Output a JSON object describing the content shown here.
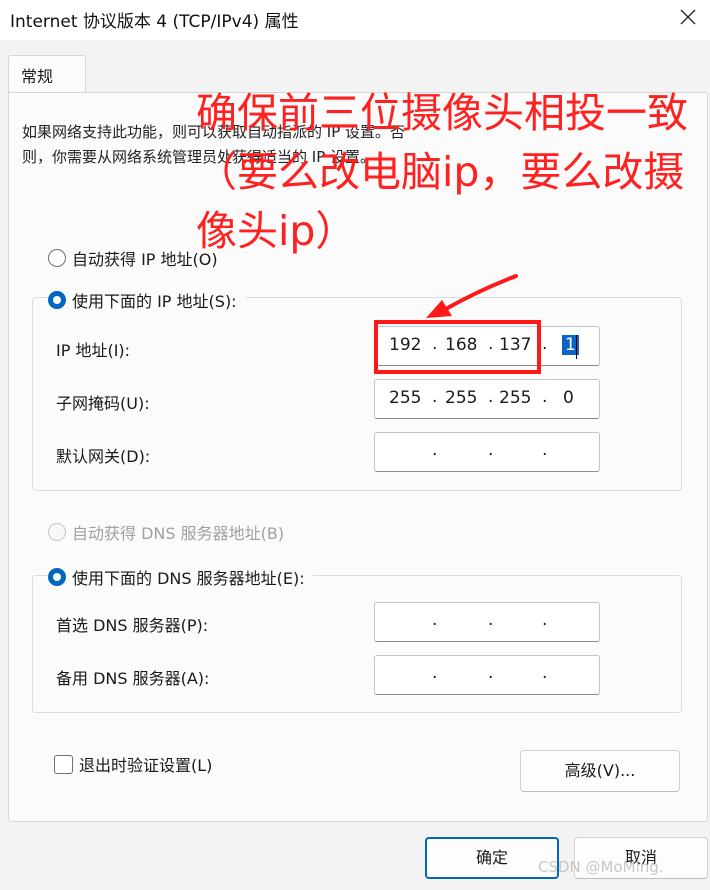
{
  "window": {
    "title": "Internet 协议版本 4 (TCP/IPv4) 属性",
    "close_icon": "close-icon"
  },
  "tabs": [
    {
      "label": "常规",
      "active": true
    }
  ],
  "description": "如果网络支持此功能，则可以获取自动指派的 IP 设置。否则，你需要从网络系统管理员处获得适当的 IP 设置。",
  "ip_section": {
    "auto_label": "自动获得 IP 地址(O)",
    "manual_label": "使用下面的 IP 地址(S):",
    "selected": "manual",
    "fields": [
      {
        "label": "IP 地址(I):",
        "octets": [
          "192",
          "168",
          "137",
          "1"
        ]
      },
      {
        "label": "子网掩码(U):",
        "octets": [
          "255",
          "255",
          "255",
          "0"
        ]
      },
      {
        "label": "默认网关(D):",
        "octets": [
          "",
          "",
          "",
          ""
        ]
      }
    ]
  },
  "dns_section": {
    "auto_label": "自动获得 DNS 服务器地址(B)",
    "manual_label": "使用下面的 DNS 服务器地址(E):",
    "selected": "manual",
    "auto_disabled": true,
    "fields": [
      {
        "label": "首选 DNS 服务器(P):",
        "octets": [
          "",
          "",
          "",
          ""
        ]
      },
      {
        "label": "备用 DNS 服务器(A):",
        "octets": [
          "",
          "",
          "",
          ""
        ]
      }
    ]
  },
  "validate_checkbox": {
    "label": "退出时验证设置(L)",
    "checked": false
  },
  "buttons": {
    "advanced": "高级(V)...",
    "ok": "确定",
    "cancel": "取消"
  },
  "annotation": {
    "text": "确保前三位摄像头相投一致（要么改电脑ip，要么改摄像头ip）",
    "color": "#ff2020"
  },
  "watermark": "CSDN @MoMing.",
  "colors": {
    "accent": "#0067c0",
    "annotation_red": "#ff1818",
    "selection": "#0b64c8"
  }
}
